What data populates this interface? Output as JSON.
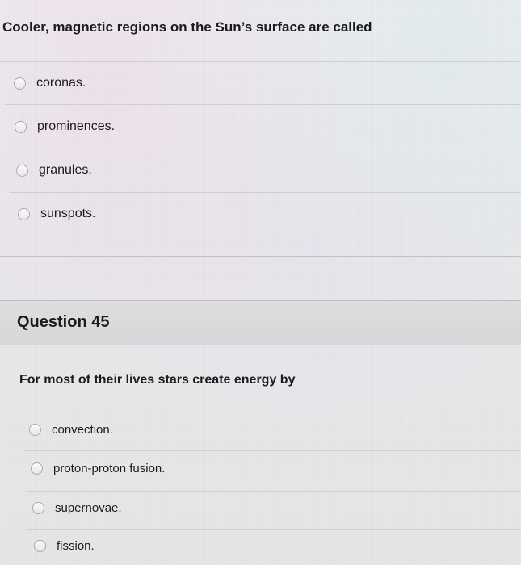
{
  "question_44": {
    "prompt": "Cooler, magnetic regions on the Sun’s surface are called",
    "options": [
      {
        "label": "coronas."
      },
      {
        "label": "prominences."
      },
      {
        "label": "granules."
      },
      {
        "label": "sunspots."
      }
    ]
  },
  "question_45": {
    "header": "Question 45",
    "prompt": "For most of their lives stars create energy by",
    "options": [
      {
        "label": "convection."
      },
      {
        "label": "proton-proton fusion."
      },
      {
        "label": "supernovae."
      },
      {
        "label": "fission."
      }
    ]
  }
}
